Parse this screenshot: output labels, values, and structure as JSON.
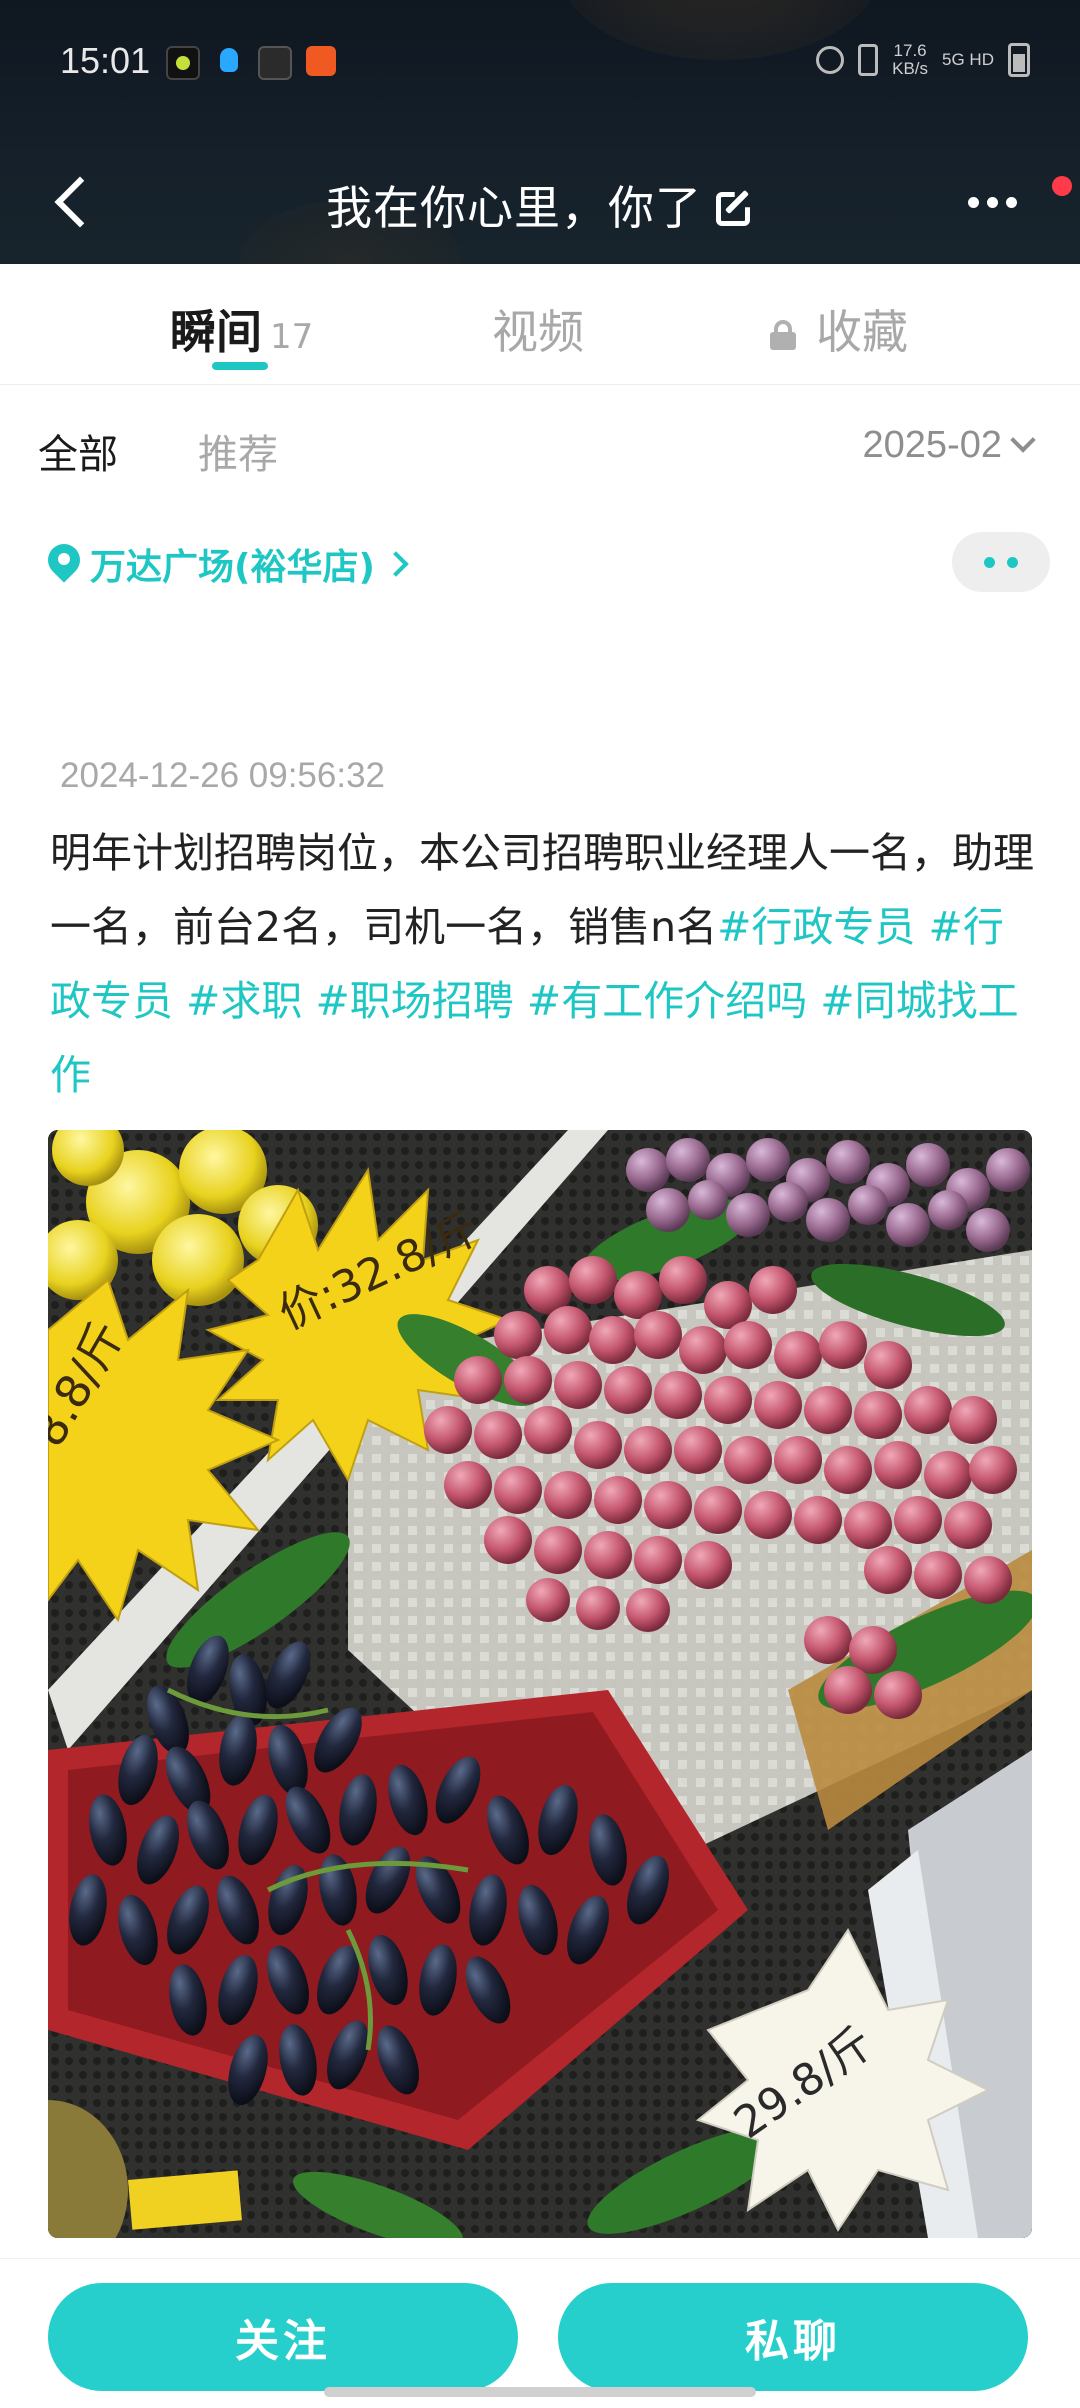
{
  "status_bar": {
    "time": "15:01",
    "speed": "17.6\nKB/s",
    "network": "5G HD"
  },
  "nav": {
    "title": "我在你心里，你了"
  },
  "tabs": [
    {
      "label": "瞬间",
      "count": "17",
      "active": true
    },
    {
      "label": "视频",
      "active": false
    },
    {
      "label": "收藏",
      "locked": true,
      "active": false
    }
  ],
  "filter": {
    "all_label": "全部",
    "recommend_label": "推荐",
    "date": "2025-02"
  },
  "location": {
    "name": "万达广场(裕华店)"
  },
  "post": {
    "timestamp": "2024-12-26 09:56:32",
    "text": "明年计划招聘岗位，本公司招聘职业经理人一名，助理一名，前台2名，司机一名，销售n名",
    "tags": [
      "#行政专员",
      "#行政专员",
      "#求职",
      "#职场招聘",
      "#有工作介绍吗",
      "#同城找工作"
    ],
    "image_alt": "超市水果货架：黄色价签、红提、黑色手指葡萄",
    "price_tags": [
      "32.8/斤",
      "8.8/斤",
      "29.8/斤"
    ]
  },
  "actions": {
    "follow_label": "关注",
    "chat_label": "私聊"
  },
  "colors": {
    "accent": "#1fc7c4",
    "button": "#26cfcc",
    "header_bg": "#15202a"
  }
}
